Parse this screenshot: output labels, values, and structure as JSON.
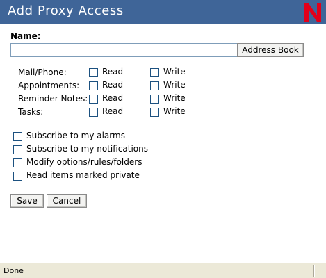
{
  "window": {
    "title": "Add Proxy Access"
  },
  "name_field": {
    "label": "Name:",
    "value": "",
    "address_book_button": "Address Book"
  },
  "permissions": [
    {
      "label": "Mail/Phone:",
      "read_label": "Read",
      "read_checked": false,
      "write_label": "Write",
      "write_checked": false
    },
    {
      "label": "Appointments:",
      "read_label": "Read",
      "read_checked": false,
      "write_label": "Write",
      "write_checked": false
    },
    {
      "label": "Reminder Notes:",
      "read_label": "Read",
      "read_checked": false,
      "write_label": "Write",
      "write_checked": false
    },
    {
      "label": "Tasks:",
      "read_label": "Read",
      "read_checked": false,
      "write_label": "Write",
      "write_checked": false
    }
  ],
  "options": [
    {
      "label": "Subscribe to my alarms",
      "checked": false
    },
    {
      "label": "Subscribe to my notifications",
      "checked": false
    },
    {
      "label": "Modify options/rules/folders",
      "checked": false
    },
    {
      "label": "Read items marked private",
      "checked": false
    }
  ],
  "buttons": {
    "save": "Save",
    "cancel": "Cancel"
  },
  "status_bar": {
    "text": "Done"
  },
  "colors": {
    "titlebar": "#3f6598",
    "logo_red": "#e2001a",
    "status_bg": "#ece9d8"
  },
  "icons": {
    "logo": "novell-n-logo"
  }
}
